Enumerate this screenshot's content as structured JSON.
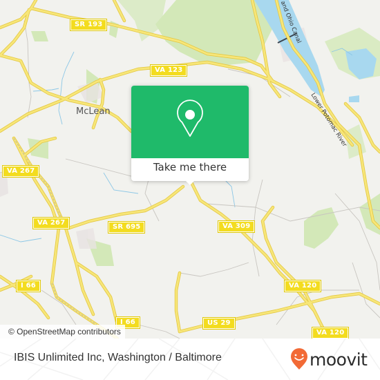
{
  "map": {
    "place_labels": [
      {
        "id": "mclean",
        "text": "McLean"
      }
    ],
    "route_shields": [
      {
        "id": "sr193",
        "text": "SR 193"
      },
      {
        "id": "va123",
        "text": "VA 123"
      },
      {
        "id": "va267a",
        "text": "VA 267"
      },
      {
        "id": "va267b",
        "text": "VA 267"
      },
      {
        "id": "sr695",
        "text": "SR 695"
      },
      {
        "id": "va309",
        "text": "VA 309"
      },
      {
        "id": "i66a",
        "text": "I 66"
      },
      {
        "id": "i66b",
        "text": "I 66"
      },
      {
        "id": "va120a",
        "text": "VA 120"
      },
      {
        "id": "va120b",
        "text": "VA 120"
      },
      {
        "id": "us29",
        "text": "US 29"
      }
    ],
    "water_labels": [
      {
        "id": "canal",
        "text": "and Ohio Canal"
      },
      {
        "id": "river",
        "text": "Lower Potomac River"
      }
    ],
    "attribution": "© OpenStreetMap contributors",
    "colors": {
      "land": "#f2f2ee",
      "road": "#f5e26b",
      "water": "#a8d8ef",
      "park": "#cfe6b0"
    }
  },
  "popup": {
    "icon": "map-pin-icon",
    "cta_label": "Take me there",
    "accent_color": "#1fba6a"
  },
  "footer": {
    "title": "IBIS Unlimited Inc, Washington / Baltimore",
    "brand_name": "moovit",
    "brand_icon": "moovit-logo-icon",
    "brand_color": "#f26a36"
  }
}
